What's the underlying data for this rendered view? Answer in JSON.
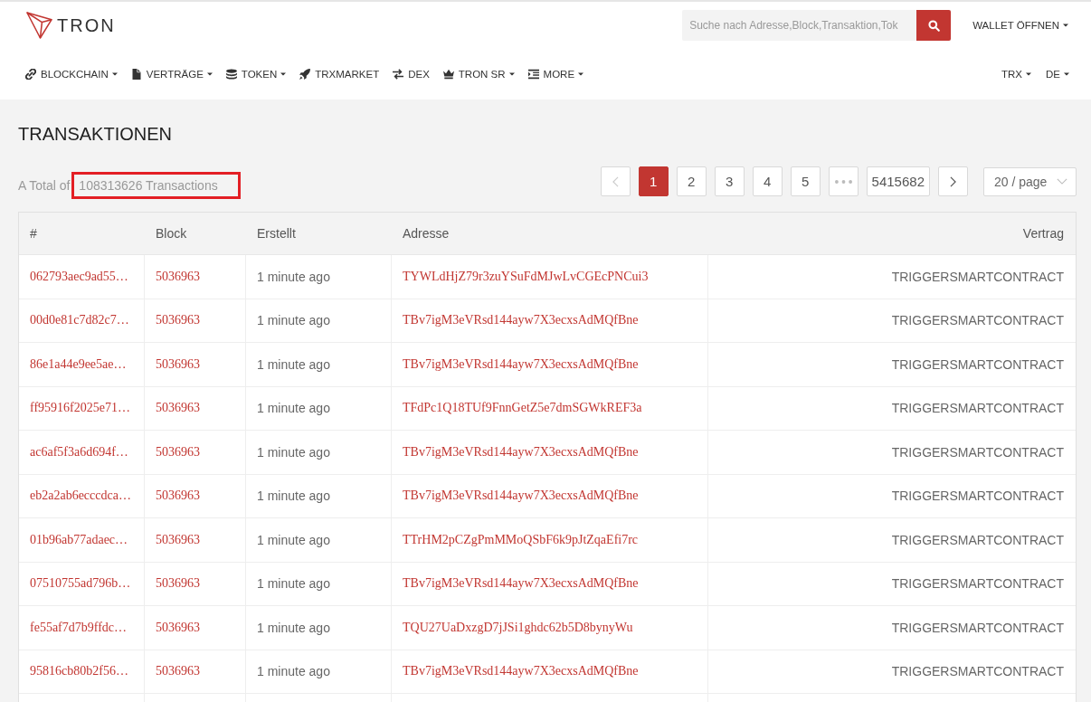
{
  "header": {
    "logo": "TRON",
    "search": {
      "placeholder": "Suche nach Adresse,Block,Transaktion,Tok"
    },
    "wallet_menu": {
      "label": "WALLET ÖFFNEN",
      "dropdown": true
    },
    "nav": [
      {
        "label": "BLOCKCHAIN",
        "dropdown": true
      },
      {
        "label": "VERTRÄGE",
        "dropdown": true
      },
      {
        "label": "TOKEN",
        "dropdown": true
      },
      {
        "label": "TRXMARKET",
        "dropdown": false
      },
      {
        "label": "DEX",
        "dropdown": false
      },
      {
        "label": "TRON SR",
        "dropdown": true
      },
      {
        "label": "MORE",
        "dropdown": true
      }
    ],
    "right_menus": [
      {
        "label": "TRX",
        "dropdown": true
      },
      {
        "label": "DE",
        "dropdown": true
      }
    ]
  },
  "page": {
    "title": "TRANSAKTIONEN",
    "total": {
      "prefix": "A Total of",
      "count": "108313626 Transactions",
      "highlighted": true
    }
  },
  "pagination": {
    "previous": {
      "disabled": true
    },
    "pages": [
      {
        "kind": "page",
        "label": "1",
        "selected": true
      },
      {
        "kind": "page",
        "label": "2",
        "selected": false
      },
      {
        "kind": "page",
        "label": "3",
        "selected": false
      },
      {
        "kind": "page",
        "label": "4",
        "selected": false
      },
      {
        "kind": "page",
        "label": "5",
        "selected": false
      },
      {
        "kind": "ellipsis",
        "selected": false
      },
      {
        "kind": "page",
        "label": "5415682",
        "selected": false
      }
    ],
    "next": {
      "disabled": false
    },
    "page_size": "20 / page"
  },
  "table": {
    "columns": [
      {
        "label": "#"
      },
      {
        "label": "Block"
      },
      {
        "label": "Erstellt"
      },
      {
        "label": "Adresse"
      },
      {
        "label": "Vertrag"
      }
    ],
    "rows": [
      {
        "hash": "062793aec9ad55…",
        "block": "5036963",
        "created": "1 minute ago",
        "address": "TYWLdHjZ79r3zuYSuFdMJwLvCGEcPNCui3",
        "contract": "TRIGGERSMARTCONTRACT"
      },
      {
        "hash": "00d0e81c7d82c7…",
        "block": "5036963",
        "created": "1 minute ago",
        "address": "TBv7igM3eVRsd144ayw7X3ecxsAdMQfBne",
        "contract": "TRIGGERSMARTCONTRACT"
      },
      {
        "hash": "86e1a44e9ee5ae…",
        "block": "5036963",
        "created": "1 minute ago",
        "address": "TBv7igM3eVRsd144ayw7X3ecxsAdMQfBne",
        "contract": "TRIGGERSMARTCONTRACT"
      },
      {
        "hash": "ff95916f2025e71…",
        "block": "5036963",
        "created": "1 minute ago",
        "address": "TFdPc1Q18TUf9FnnGetZ5e7dmSGWkREF3a",
        "contract": "TRIGGERSMARTCONTRACT"
      },
      {
        "hash": "ac6af5f3a6d694f…",
        "block": "5036963",
        "created": "1 minute ago",
        "address": "TBv7igM3eVRsd144ayw7X3ecxsAdMQfBne",
        "contract": "TRIGGERSMARTCONTRACT"
      },
      {
        "hash": "eb2a2ab6ecccdca…",
        "block": "5036963",
        "created": "1 minute ago",
        "address": "TBv7igM3eVRsd144ayw7X3ecxsAdMQfBne",
        "contract": "TRIGGERSMARTCONTRACT"
      },
      {
        "hash": "01b96ab77adaec…",
        "block": "5036963",
        "created": "1 minute ago",
        "address": "TTrHM2pCZgPmMMoQSbF6k9pJtZqaEfi7rc",
        "contract": "TRIGGERSMARTCONTRACT"
      },
      {
        "hash": "07510755ad796b…",
        "block": "5036963",
        "created": "1 minute ago",
        "address": "TBv7igM3eVRsd144ayw7X3ecxsAdMQfBne",
        "contract": "TRIGGERSMARTCONTRACT"
      },
      {
        "hash": "fe55af7d7b9ffdc…",
        "block": "5036963",
        "created": "1 minute ago",
        "address": "TQU27UaDxzgD7jJSi1ghdc62b5D8bynyWu",
        "contract": "TRIGGERSMARTCONTRACT"
      },
      {
        "hash": "95816cb80b2f56…",
        "block": "5036963",
        "created": "1 minute ago",
        "address": "TBv7igM3eVRsd144ayw7X3ecxsAdMQfBne",
        "contract": "TRIGGERSMARTCONTRACT"
      }
    ]
  }
}
